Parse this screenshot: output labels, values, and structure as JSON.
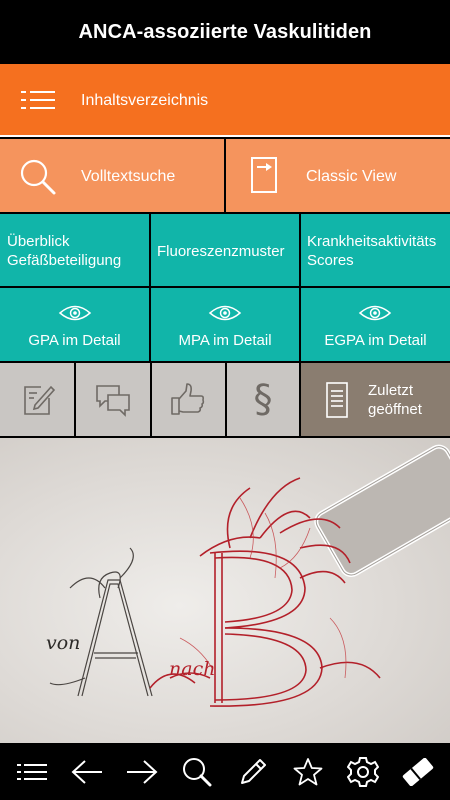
{
  "app": {
    "title": "ANCA-assoziierte Vaskulitiden"
  },
  "menu": {
    "contents": {
      "label": "Inhaltsverzeichnis",
      "icon": "list-icon"
    },
    "fulltext_search": {
      "label": "Volltextsuche",
      "icon": "search-icon"
    },
    "classic_view": {
      "label": "Classic View",
      "icon": "document-arrow-icon"
    },
    "overview_vessels": {
      "label": "Überblick Gefäßbeteiligung"
    },
    "fluorescence": {
      "label": "Fluoreszenzmuster"
    },
    "activity_scores": {
      "label": "Krankheitsaktivitäts Scores"
    },
    "gpa": {
      "label": "GPA im Detail",
      "icon": "eye-icon"
    },
    "mpa": {
      "label": "MPA im Detail",
      "icon": "eye-icon"
    },
    "egpa": {
      "label": "EGPA im Detail",
      "icon": "eye-icon"
    },
    "notes": {
      "icon": "note-edit-icon"
    },
    "discussion": {
      "icon": "chat-bubbles-icon"
    },
    "like": {
      "icon": "thumbs-up-icon"
    },
    "legal": {
      "icon": "paragraph-icon",
      "glyph": "§"
    },
    "recent": {
      "label": "Zuletzt geöffnet",
      "icon": "document-lines-icon"
    }
  },
  "hero": {
    "text_von": "von",
    "letter_a": "A",
    "text_nach": "nach",
    "letter_b": "B"
  },
  "toolbar": {
    "icons": [
      "list-icon",
      "back-arrow-icon",
      "forward-arrow-icon",
      "search-icon",
      "pencil-icon",
      "star-icon",
      "gear-icon",
      "eraser-icon"
    ]
  },
  "colors": {
    "orange_dark": "#f5701f",
    "orange_light": "#f5945d",
    "teal": "#11b5a9",
    "gray_light": "#c9c6c3",
    "gray_dark": "#8a7d70",
    "hero_red": "#b3202a"
  }
}
